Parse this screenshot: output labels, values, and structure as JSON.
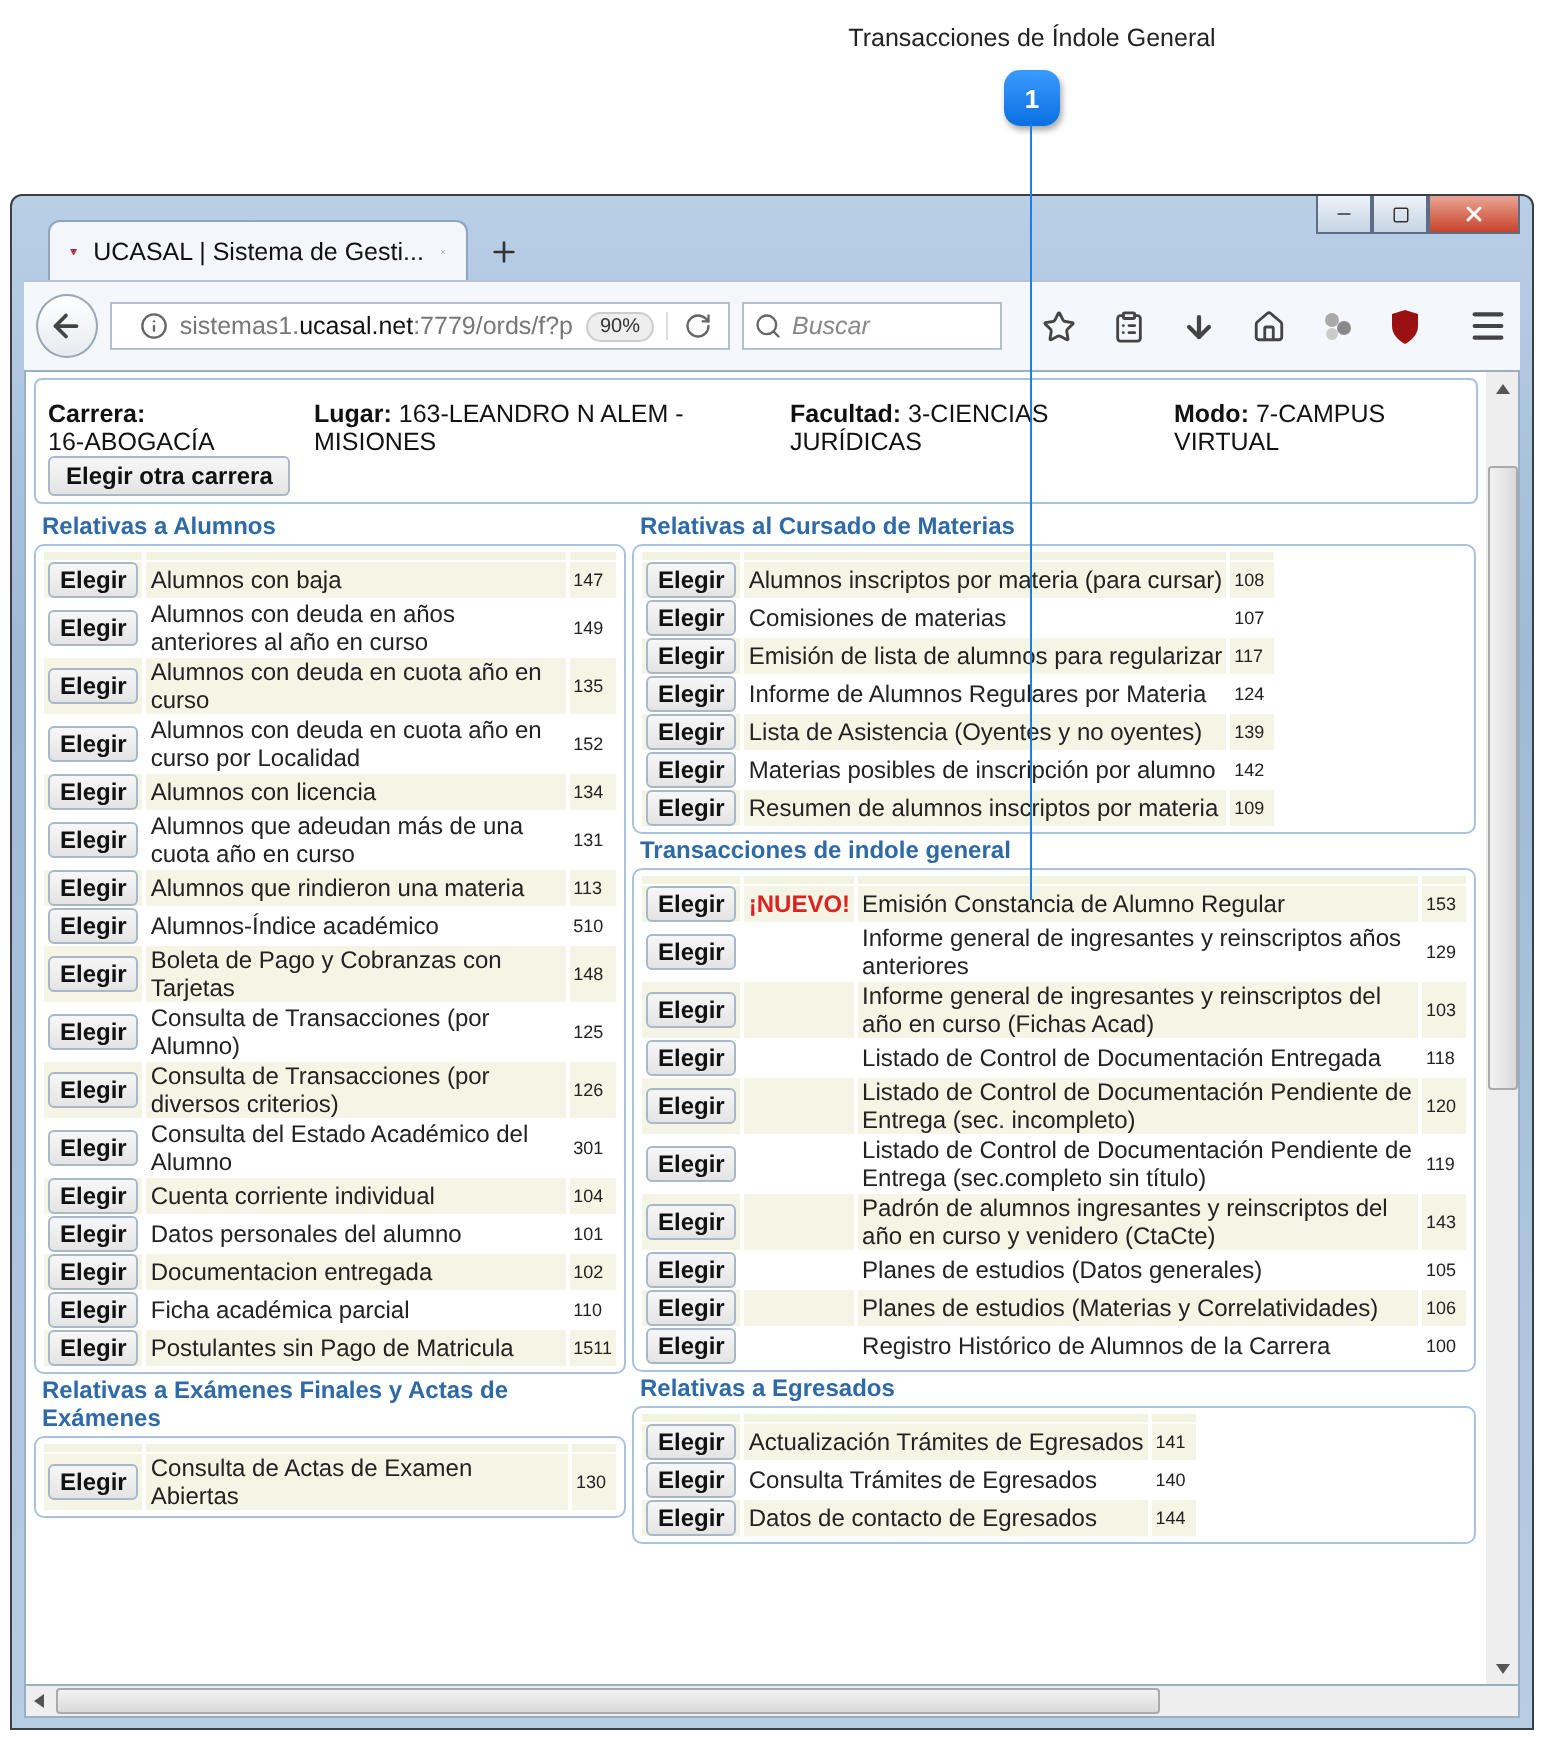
{
  "callout": {
    "number": "1",
    "title": "Transacciones de Índole General"
  },
  "browser": {
    "tab_title": "UCASAL | Sistema de Gesti...",
    "url": {
      "prefix": "sistemas1.",
      "domain": "ucasal.net",
      "suffix": ":7779/ords/f?p"
    },
    "zoom": "90%",
    "search": {
      "placeholder": "Buscar"
    }
  },
  "header": {
    "fields": [
      {
        "label": "Carrera:",
        "value": "16-ABOGACÍA"
      },
      {
        "label": "Lugar:",
        "value": "163-LEANDRO N ALEM - MISIONES"
      },
      {
        "label": "Facultad:",
        "value": "3-CIENCIAS JURÍDICAS"
      },
      {
        "label": "Modo:",
        "value": "7-CAMPUS VIRTUAL"
      }
    ],
    "button": "Elegir otra carrera"
  },
  "columns": [
    {
      "sections": [
        {
          "title": "Relativas a Alumnos",
          "kind": "full",
          "rows": [
            {
              "button": "Elegir",
              "text": "Alumnos con baja",
              "code": "147"
            },
            {
              "button": "Elegir",
              "text": "Alumnos con deuda en años anteriores al año en curso",
              "code": "149"
            },
            {
              "button": "Elegir",
              "text": "Alumnos con deuda en cuota año en curso",
              "code": "135"
            },
            {
              "button": "Elegir",
              "text": "Alumnos con deuda en cuota año en curso por Localidad",
              "code": "152"
            },
            {
              "button": "Elegir",
              "text": "Alumnos con licencia",
              "code": "134"
            },
            {
              "button": "Elegir",
              "text": "Alumnos que adeudan más de una cuota año en curso",
              "code": "131"
            },
            {
              "button": "Elegir",
              "text": "Alumnos que rindieron una materia",
              "code": "113"
            },
            {
              "button": "Elegir",
              "text": "Alumnos-Índice académico",
              "code": "510"
            },
            {
              "button": "Elegir",
              "text": "Boleta de Pago y Cobranzas con Tarjetas",
              "code": "148"
            },
            {
              "button": "Elegir",
              "text": "Consulta de Transacciones (por Alumno)",
              "code": "125"
            },
            {
              "button": "Elegir",
              "text": "Consulta de Transacciones (por diversos criterios)",
              "code": "126"
            },
            {
              "button": "Elegir",
              "text": "Consulta del Estado Académico del Alumno",
              "code": "301"
            },
            {
              "button": "Elegir",
              "text": "Cuenta corriente individual",
              "code": "104"
            },
            {
              "button": "Elegir",
              "text": "Datos personales del alumno",
              "code": "101"
            },
            {
              "button": "Elegir",
              "text": "Documentacion entregada",
              "code": "102"
            },
            {
              "button": "Elegir",
              "text": "Ficha académica parcial",
              "code": "110"
            },
            {
              "button": "Elegir",
              "text": "Postulantes sin Pago de Matricula",
              "code": "1511"
            }
          ]
        },
        {
          "title": "Relativas a Exámenes Finales y Actas de Exámenes",
          "kind": "full",
          "rows": [
            {
              "button": "Elegir",
              "text": "Consulta de Actas de Examen Abiertas",
              "code": "130"
            }
          ]
        }
      ]
    },
    {
      "sections": [
        {
          "title": "Relativas al Cursado de Materias",
          "kind": "compact",
          "rows": [
            {
              "button": "Elegir",
              "text": "Alumnos inscriptos por materia (para cursar)",
              "code": "108"
            },
            {
              "button": "Elegir",
              "text": "Comisiones de materias",
              "code": "107"
            },
            {
              "button": "Elegir",
              "text": "Emisión de lista de alumnos para regularizar",
              "code": "117"
            },
            {
              "button": "Elegir",
              "text": "Informe de Alumnos Regulares por Materia",
              "code": "124"
            },
            {
              "button": "Elegir",
              "text": "Lista de Asistencia (Oyentes y no oyentes)",
              "code": "139"
            },
            {
              "button": "Elegir",
              "text": "Materias posibles de inscripción por alumno",
              "code": "142"
            },
            {
              "button": "Elegir",
              "text": "Resumen de alumnos inscriptos por materia",
              "code": "109"
            }
          ]
        },
        {
          "title": "Transacciones de indole general",
          "kind": "full",
          "rows": [
            {
              "button": "Elegir",
              "tag": "¡NUEVO!",
              "text": "Emisión Constancia de Alumno Regular",
              "code": "153"
            },
            {
              "button": "Elegir",
              "text": "Informe general de ingresantes y reinscriptos años anteriores",
              "code": "129"
            },
            {
              "button": "Elegir",
              "text": "Informe general de ingresantes y reinscriptos del año en curso (Fichas Acad)",
              "code": "103"
            },
            {
              "button": "Elegir",
              "text": "Listado de Control de Documentación Entregada",
              "code": "118"
            },
            {
              "button": "Elegir",
              "text": "Listado de Control de Documentación Pendiente de Entrega (sec. incompleto)",
              "code": "120"
            },
            {
              "button": "Elegir",
              "text": "Listado de Control de Documentación Pendiente de Entrega (sec.completo sin título)",
              "code": "119"
            },
            {
              "button": "Elegir",
              "text": "Padrón de alumnos ingresantes y reinscriptos del año en curso y venidero (CtaCte)",
              "code": "143"
            },
            {
              "button": "Elegir",
              "text": "Planes de estudios (Datos generales)",
              "code": "105"
            },
            {
              "button": "Elegir",
              "text": "Planes de estudios (Materias y Correlatividades)",
              "code": "106"
            },
            {
              "button": "Elegir",
              "text": "Registro Histórico de Alumnos de la Carrera",
              "code": "100"
            }
          ]
        },
        {
          "title": "Relativas a Egresados",
          "kind": "compact",
          "rows": [
            {
              "button": "Elegir",
              "text": "Actualización Trámites de Egresados",
              "code": "141"
            },
            {
              "button": "Elegir",
              "text": "Consulta Trámites de Egresados",
              "code": "140"
            },
            {
              "button": "Elegir",
              "text": "Datos de contacto de Egresados",
              "code": "144"
            }
          ]
        }
      ]
    }
  ]
}
